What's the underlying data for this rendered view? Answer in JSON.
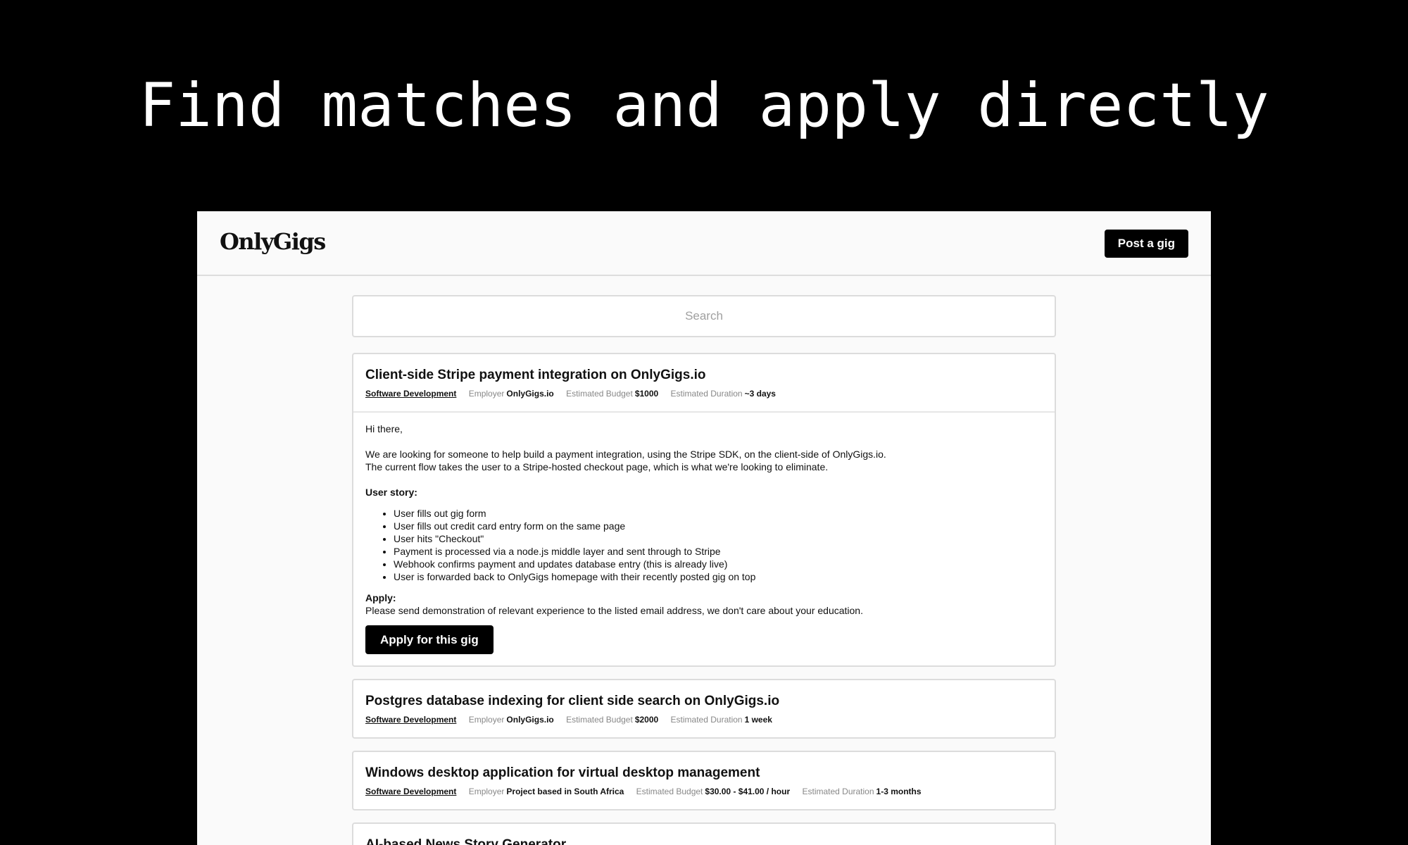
{
  "hero": {
    "title": "Find matches and apply directly"
  },
  "app": {
    "logo": "OnlyGigs",
    "post_button": "Post a gig",
    "search_placeholder": "Search"
  },
  "labels": {
    "employer": "Employer",
    "budget": "Estimated Budget",
    "duration": "Estimated Duration"
  },
  "gigs": [
    {
      "title": "Client-side Stripe payment integration on OnlyGigs.io",
      "category": "Software Development",
      "employer": "OnlyGigs.io",
      "budget": "$1000",
      "duration": "~3 days",
      "body": {
        "greeting": "Hi there,",
        "intro_1": "We are looking for someone to help build a payment integration, using the Stripe SDK, on the client-side of OnlyGigs.io.",
        "intro_2": "The current flow takes the user to a Stripe-hosted checkout page, which is what we're looking to eliminate.",
        "user_story_label": "User story:",
        "user_story": [
          "User fills out gig form",
          "User fills out credit card entry form on the same page",
          "User hits \"Checkout\"",
          "Payment is processed via a node.js middle layer and sent through to Stripe",
          "Webhook confirms payment and updates database entry (this is already live)",
          "User is forwarded back to OnlyGigs homepage with their recently posted gig on top"
        ],
        "apply_label": "Apply:",
        "apply_text": "Please send demonstration of relevant experience to the listed email address, we don't care about your education.",
        "apply_button": "Apply for this gig"
      }
    },
    {
      "title": "Postgres database indexing for client side search on OnlyGigs.io",
      "category": "Software Development",
      "employer": "OnlyGigs.io",
      "budget": "$2000",
      "duration": "1 week"
    },
    {
      "title": "Windows desktop application for virtual desktop management",
      "category": "Software Development",
      "employer": "Project based in South Africa",
      "budget": "$30.00 - $41.00 / hour",
      "duration": "1-3 months"
    },
    {
      "title": "AI-based News Story Generator"
    }
  ]
}
